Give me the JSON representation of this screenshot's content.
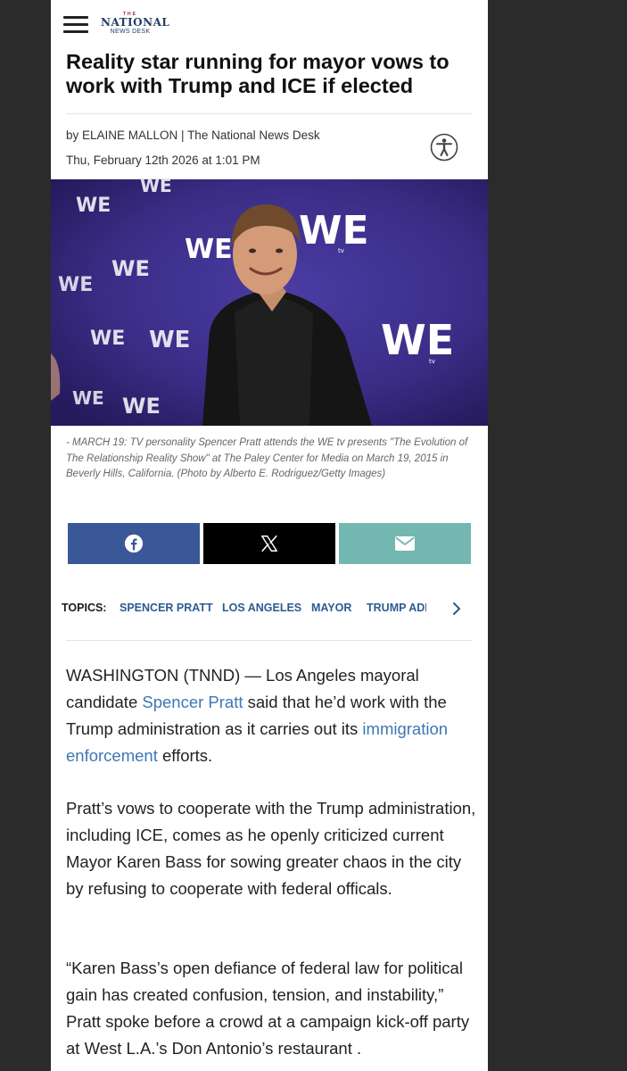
{
  "header": {
    "logo_the": "THE",
    "logo_name": "NATIONAL",
    "logo_sub": "NEWS DESK"
  },
  "article": {
    "headline": "Reality star running for mayor vows to work with Trump and ICE if elected",
    "byline_by": "by ELAINE MALLON",
    "byline_sep": " | ",
    "byline_outlet": "The National News Desk",
    "date": "Thu, February 12th 2026 at 1:01 PM",
    "photo_banner_text": "WE",
    "photo_banner_sub": "tv",
    "caption": "- MARCH 19: TV personality Spencer Pratt attends the WE tv presents \"The Evolution of The Relationship Reality Show\" at The Paley Center for Media on March 19, 2015 in Beverly Hills, California. (Photo by Alberto E. Rodriguez/Getty Images)"
  },
  "share": {
    "facebook_icon": "facebook-icon",
    "x_icon": "x-logo-icon",
    "email_icon": "envelope-icon"
  },
  "topics": {
    "label": "TOPICS:",
    "items": [
      "SPENCER PRATT",
      "LOS ANGELES",
      "MAYOR",
      "TRUMP ADMINISTRATION"
    ]
  },
  "body": {
    "p1_a": "WASHINGTON (TNND) — Los Angeles mayoral candidate ",
    "p1_link1": "Spencer Pratt",
    "p1_b": " said that he’d work with the Trump administration as it carries out its ",
    "p1_link2": "immigration enforcement",
    "p1_c": " efforts.",
    "p2": "Pratt’s vows to cooperate with the Trump administration, including ICE, comes as he openly criticized current Mayor Karen Bass for sowing greater chaos in the city by refusing to cooperate with federal officals.",
    "p3": "“Karen Bass’s open defiance of federal law for political gain has created confusion, tension, and instability,” Pratt spoke before a crowd at a campaign kick-off party at West L.A.’s Don Antonio’s restaurant ."
  },
  "colors": {
    "backdrop": "#2b2b2b",
    "brand_navy": "#223e66",
    "link_blue": "#3d77b5",
    "topic_blue": "#2c5b91",
    "facebook": "#3a5898",
    "x": "#000000",
    "email": "#73b8b0",
    "photo_background": "#3b2d86"
  }
}
